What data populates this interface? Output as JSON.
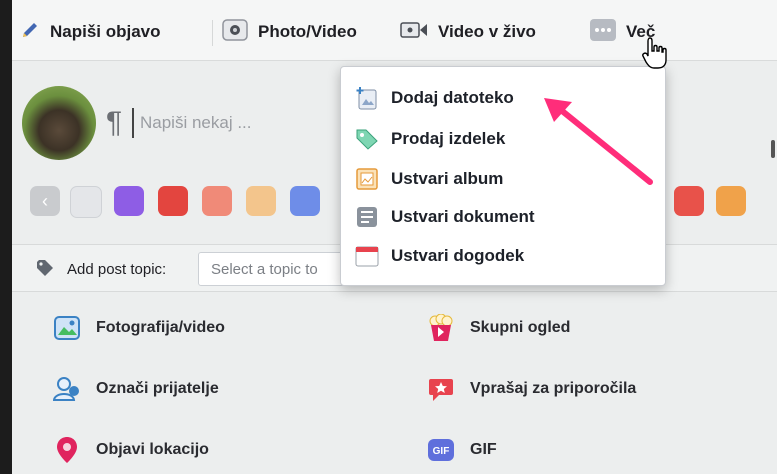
{
  "tabs": {
    "write_post": "Napiši objavo",
    "photo_video": "Photo/Video",
    "live_video": "Video v živo",
    "more": "Več"
  },
  "composer": {
    "placeholder": "Napiši nekaj ..."
  },
  "colors": {
    "swatches": [
      "#8e5de5",
      "#e3453f",
      "#f08a78",
      "#f3c58c",
      "#6e8de8",
      "#e8524a",
      "#f0a24a"
    ]
  },
  "topic": {
    "label": "Add post topic:",
    "placeholder": "Select a topic to"
  },
  "more_menu": {
    "items": [
      {
        "label": "Dodaj datoteko",
        "icon": "add-file-icon"
      },
      {
        "label": "Prodaj izdelek",
        "icon": "tag-icon"
      },
      {
        "label": "Ustvari album",
        "icon": "album-icon"
      },
      {
        "label": "Ustvari dokument",
        "icon": "document-icon"
      },
      {
        "label": "Ustvari dogodek",
        "icon": "calendar-icon"
      }
    ]
  },
  "actions": {
    "photo_video": "Fotografija/video",
    "watch_party": "Skupni ogled",
    "tag_friends": "Označi prijatelje",
    "ask_recommendations": "Vprašaj za priporočila",
    "check_in": "Objavi lokacijo",
    "gif": "GIF"
  },
  "accent": "#ff2d7a"
}
